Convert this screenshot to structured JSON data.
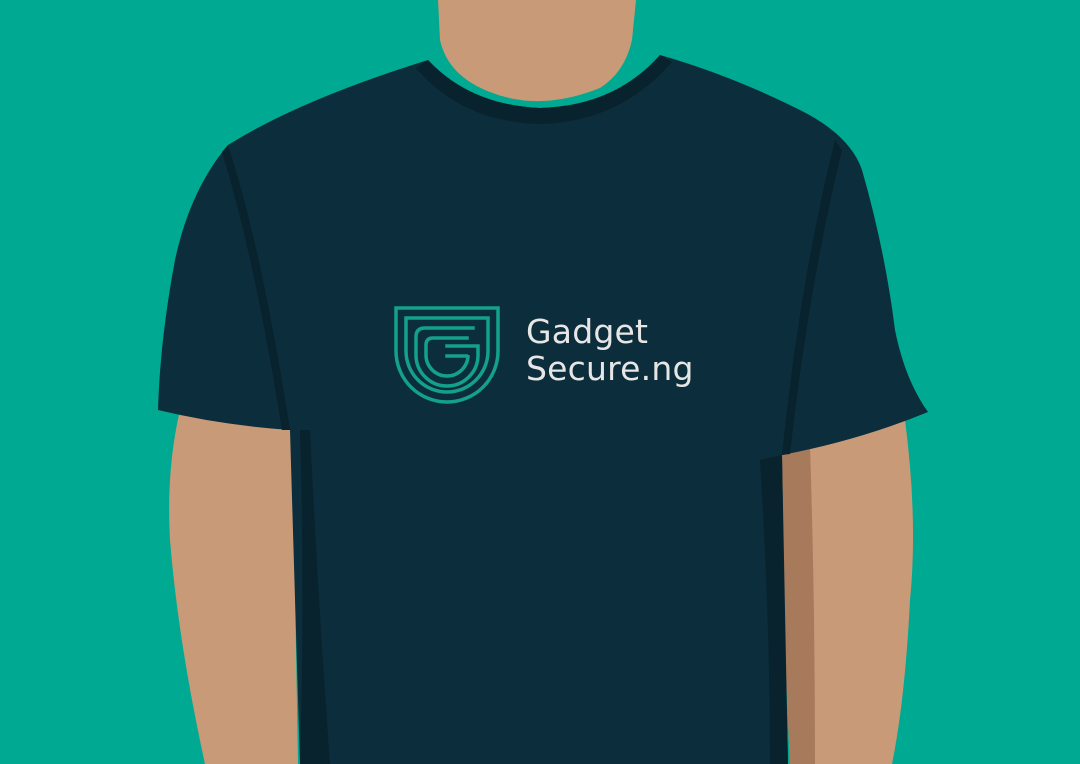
{
  "colors": {
    "background": "#00A991",
    "shirt": "#0C2D3B",
    "shirt_shadow": "#08222E",
    "skin": "#C99A78",
    "skin_shadow": "#A87A5C",
    "logo_accent": "#13A289",
    "logo_text": "#E6E6E6"
  },
  "logo": {
    "icon": "shield-g-icon",
    "line1": "Gadget",
    "line2": "Secure.ng"
  }
}
